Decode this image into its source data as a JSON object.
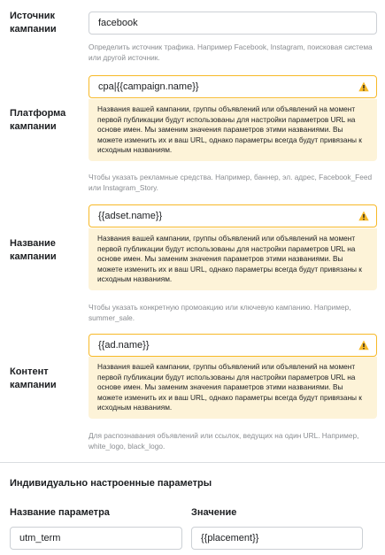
{
  "source": {
    "label": "Источник кампании",
    "value": "facebook",
    "hint": "Определить источник трафика. Например Facebook, Instagram, поисковая система или другой источник."
  },
  "warning_text": "Названия вашей кампании, группы объявлений или объявлений на момент первой публикации будут использованы для настройки параметров URL на основе имен. Мы заменим значения параметров этими названиями. Вы можете изменить их и ваш URL, однако параметры всегда будут привязаны к исходным названиям.",
  "medium": {
    "label": "Платформа кампании",
    "value": "cpa|{{campaign.name}}",
    "hint": "Чтобы указать рекламные средства. Например, баннер, эл. адрес, Facebook_Feed или Instagram_Story."
  },
  "name": {
    "label": "Название кампании",
    "value": "{{adset.name}}",
    "hint": "Чтобы указать конкретную промоакцию или ключевую кампанию. Например, summer_sale."
  },
  "content": {
    "label": "Контент кампании",
    "value": "{{ad.name}}",
    "hint": "Для распознавания объявлений или ссылок, ведущих на один URL. Например, white_logo, black_logo."
  },
  "custom": {
    "title": "Индивидуально настроенные параметры",
    "param_label": "Название параметра",
    "value_label": "Значение",
    "param_value": "utm_term",
    "value_value": "{{placement}}"
  },
  "colors": {
    "warning_border": "#f7b928",
    "warning_bg": "#fdf3d8",
    "warning_icon": "#f7b928"
  },
  "icons": {
    "warning": "warning-triangle-icon"
  }
}
